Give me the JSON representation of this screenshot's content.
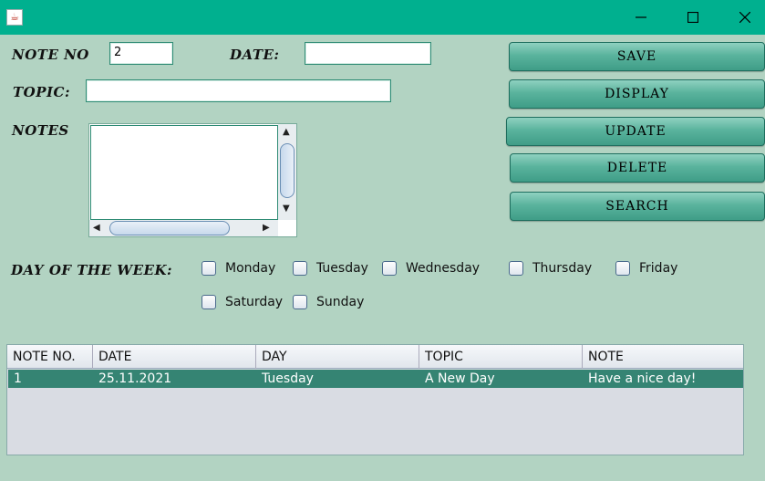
{
  "window": {
    "app_icon": "java-cup-icon",
    "controls": [
      "minimize",
      "maximize",
      "close"
    ]
  },
  "form": {
    "note_no_label": "NOTE NO",
    "note_no_value": "2",
    "date_label": "DATE:",
    "date_value": "",
    "topic_label": "TOPIC:",
    "topic_value": "",
    "notes_label": "NOTES",
    "notes_value": "",
    "day_label": "DAY OF THE WEEK:"
  },
  "buttons": {
    "save": "SAVE",
    "display": "DISPLAY",
    "update": "UPDATE",
    "delete": "DELETE",
    "search": "SEARCH"
  },
  "days": {
    "monday": "Monday",
    "tuesday": "Tuesday",
    "wednesday": "Wednesday",
    "thursday": "Thursday",
    "friday": "Friday",
    "saturday": "Saturday",
    "sunday": "Sunday"
  },
  "table": {
    "headers": [
      "NOTE NO.",
      "DATE",
      "DAY",
      "TOPIC",
      "NOTE"
    ],
    "rows": [
      [
        "1",
        "25.11.2021",
        "Tuesday",
        "A New Day",
        "Have a nice day!"
      ]
    ]
  },
  "colors": {
    "titlebar": "#00b08f",
    "background": "#b2d3c2",
    "button": "#5ab39d",
    "selected_row": "#358473"
  }
}
